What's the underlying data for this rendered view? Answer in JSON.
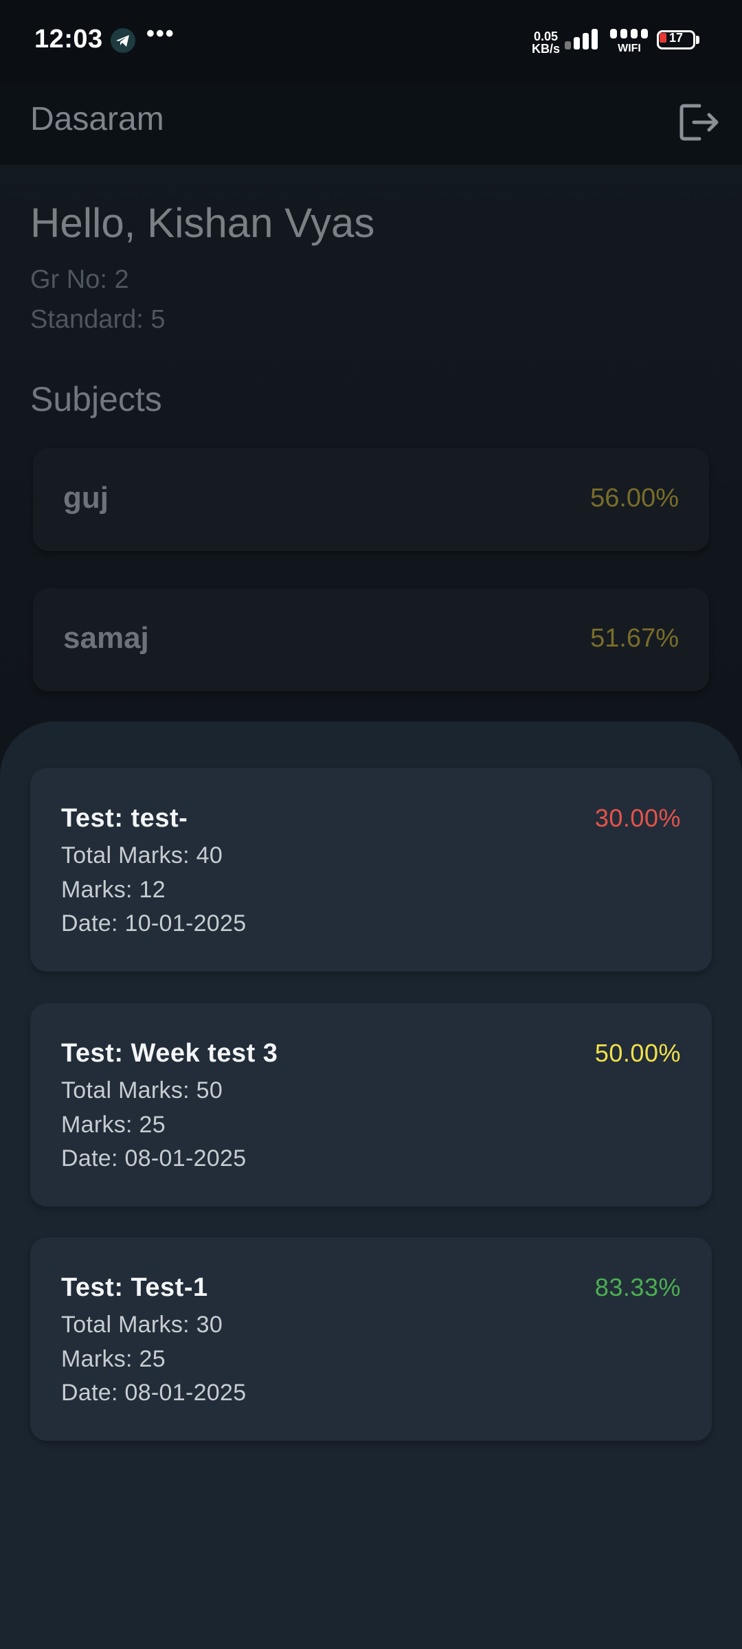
{
  "status_bar": {
    "time": "12:03",
    "net_speed_value": "0.05",
    "net_speed_unit": "KB/s",
    "wifi_label": "WIFI",
    "battery_level": "17",
    "notification_icons": [
      "telegram-icon",
      "more-dots-icon"
    ]
  },
  "app_bar": {
    "title": "Dasaram",
    "logout_icon": "logout-icon"
  },
  "student": {
    "greeting": "Hello, Kishan Vyas",
    "gr_no": "Gr No: 2",
    "standard": "Standard: 5"
  },
  "subjects_title": "Subjects",
  "subjects": [
    {
      "name": "guj",
      "percent": "56.00%"
    },
    {
      "name": "samaj",
      "percent": "51.67%"
    }
  ],
  "tests": [
    {
      "title": "Test: test-",
      "percent": "30.00%",
      "percent_color": "#e5534b",
      "total_marks": "Total Marks: 40",
      "marks": "Marks: 12",
      "date": "Date: 10-01-2025"
    },
    {
      "title": "Test: Week test 3",
      "percent": "50.00%",
      "percent_color": "#f2e14a",
      "total_marks": "Total Marks: 50",
      "marks": "Marks: 25",
      "date": "Date: 08-01-2025"
    },
    {
      "title": "Test: Test-1",
      "percent": "83.33%",
      "percent_color": "#4caf50",
      "total_marks": "Total Marks: 30",
      "marks": "Marks: 25",
      "date": "Date: 08-01-2025"
    }
  ],
  "colors": {
    "background": "#0b0f14",
    "sheet": "#1b2530",
    "card": "#222d39",
    "subject_percent": "#7a6d2a"
  }
}
